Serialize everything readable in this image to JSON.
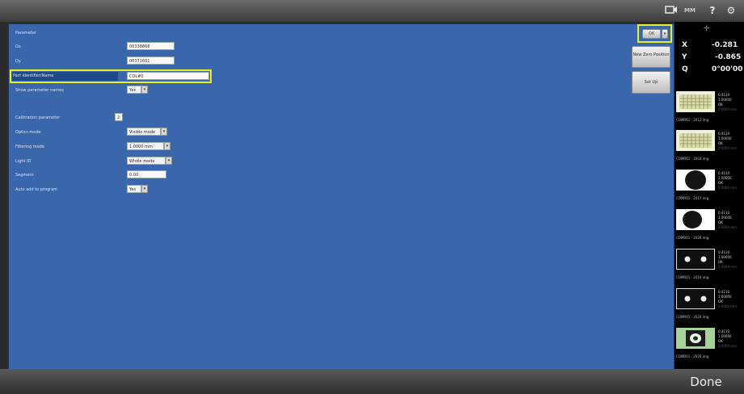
{
  "toolbar": {
    "camera_icon": "camera-icon",
    "mode_label": "MM",
    "help_label": "?",
    "settings_label": "⚙"
  },
  "form": {
    "section_title": "Parameter",
    "rows": [
      {
        "label": "Dx",
        "value": "00338868"
      },
      {
        "label": "Dy",
        "value": "00371601"
      },
      {
        "label": "Part identifier/Name",
        "value": "COL#0"
      },
      {
        "label": "Show parameter names",
        "value": "Yes"
      },
      {
        "label": "Calibration parameter",
        "value": "2"
      },
      {
        "label": "Optics mode",
        "value": "Visible mode"
      },
      {
        "label": "Filtering mode",
        "value": "1.0000 mm"
      },
      {
        "label": "Light ID",
        "value": "Whole mode"
      },
      {
        "label": "Segment",
        "value": "0.00"
      },
      {
        "label": "Auto add to program",
        "value": "Yes"
      }
    ]
  },
  "buttons": {
    "ok": "OK",
    "set_zero": "New Zero Position",
    "set_up": "Set Up"
  },
  "readout": {
    "x_label": "X",
    "x_value": "-0.281",
    "y_label": "Y",
    "y_value": "-0.865",
    "q_label": "Q",
    "q_value": "0°00'00"
  },
  "thumbnails": [
    {
      "type": "grid",
      "l1": "0.4110",
      "l2": "1.00000",
      "l3": "OK",
      "l4": "0.0000 mm",
      "caption": "COMR01 - 2012 img"
    },
    {
      "type": "grid",
      "l1": "0.4110",
      "l2": "1.00000",
      "l3": "OK",
      "l4": "0.0000 mm",
      "caption": "COMR01 - 2004 img"
    },
    {
      "type": "dark-circle",
      "l1": "0.4110",
      "l2": "1.00000",
      "l3": "OK",
      "l4": "0.0000 mm",
      "caption": "COMR01 - 2017 img"
    },
    {
      "type": "dark-circle-left",
      "l1": "0.4110",
      "l2": "1.00000",
      "l3": "OK",
      "l4": "0.0000 mm",
      "caption": "COMR01 - 2026 img"
    },
    {
      "type": "two-dots",
      "l1": "0.4110",
      "l2": "1.00000",
      "l3": "OK",
      "l4": "0.0000 mm",
      "caption": "COMR01 - 2019 img"
    },
    {
      "type": "two-dots",
      "l1": "0.4110",
      "l2": "1.00000",
      "l3": "OK",
      "l4": "0.0000 mm",
      "caption": "COMR01 - 2026 img"
    },
    {
      "type": "green-circle",
      "l1": "0.4110",
      "l2": "1.00000",
      "l3": "OK",
      "l4": "0.0000 mm",
      "caption": "COMR01 - 2026 img"
    }
  ],
  "footer": {
    "done_label": "Done"
  }
}
